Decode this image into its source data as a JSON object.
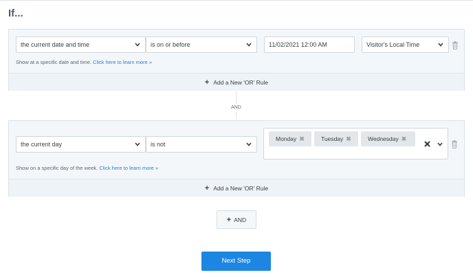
{
  "heading": "If...",
  "rule1": {
    "condition": "the current date and time",
    "operator": "is on or before",
    "value": "11/02/2021 12:00 AM",
    "timezone": "Visitor's Local Time",
    "hint_text": "Show at a specific date and time.",
    "hint_link": "Click here to learn more »",
    "or_label": "Add a New 'OR' Rule"
  },
  "connector": "AND",
  "rule2": {
    "condition": "the current day",
    "operator": "is not",
    "tags": [
      "Monday",
      "Tuesday",
      "Wednesday"
    ],
    "hint_text": "Show on a specific day of the week.",
    "hint_link": "Click here to learn more »",
    "or_label": "Add a New 'OR' Rule"
  },
  "and_button": "AND",
  "next_button": "Next Step",
  "icons": {
    "plus": "+",
    "remove": "✖"
  }
}
